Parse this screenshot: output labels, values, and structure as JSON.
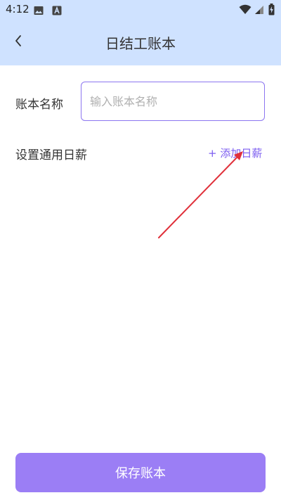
{
  "status_bar": {
    "time": "4:12",
    "icons": [
      "image-icon",
      "a-badge-icon",
      "wifi-icon",
      "signal-icon",
      "battery-charging-icon"
    ]
  },
  "header": {
    "title": "日结工账本",
    "back_icon": "chevron-left-icon"
  },
  "form": {
    "name_label": "账本名称",
    "name_placeholder": "输入账本名称",
    "name_value": "",
    "wage_label": "设置通用日薪",
    "add_wage_label": "+ 添加日薪"
  },
  "footer": {
    "save_label": "保存账本"
  },
  "colors": {
    "header_bg": "#cfe2ff",
    "accent": "#7b5cf0",
    "button_bg": "#9b7ef5",
    "annotation_arrow": "#e0303a"
  }
}
